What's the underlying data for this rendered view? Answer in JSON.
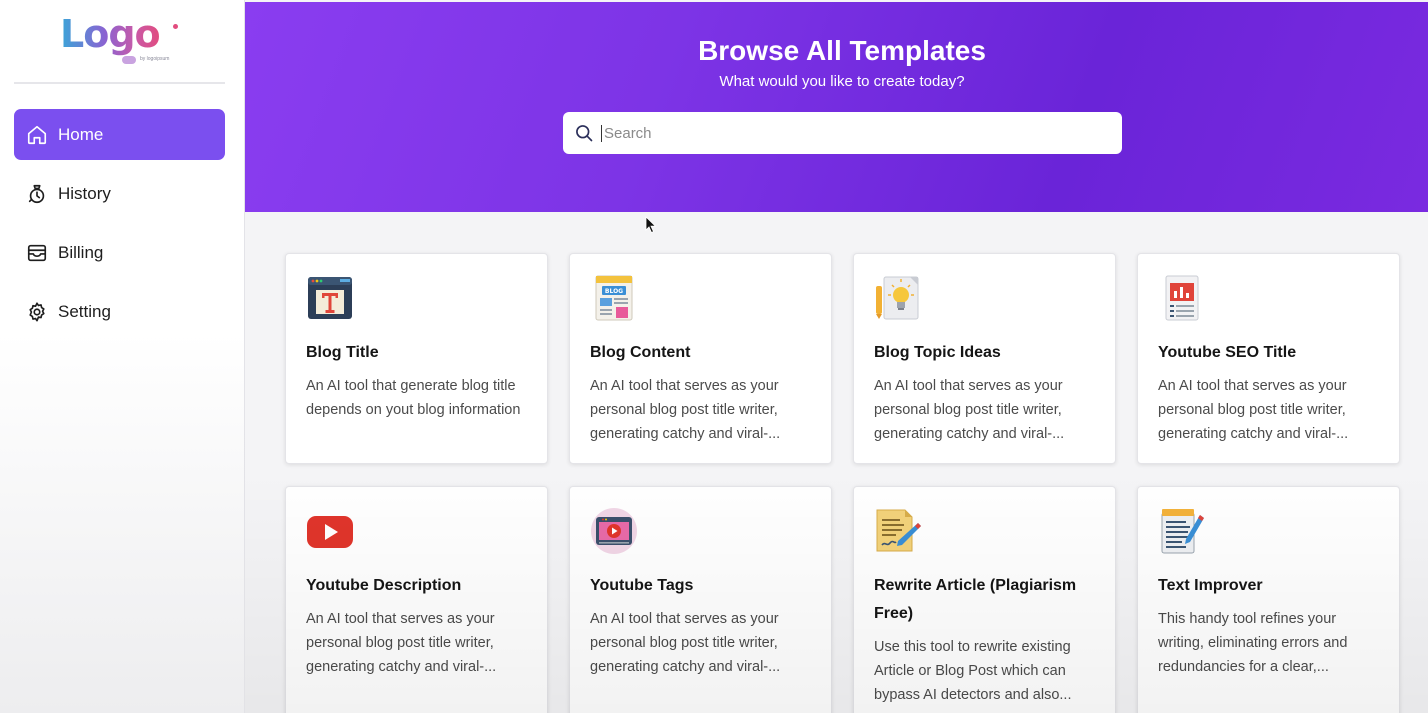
{
  "sidebar": {
    "logo_text": "Logo",
    "logo_sub": "by logoipsum",
    "items": [
      {
        "label": "Home",
        "icon": "home-icon",
        "active": true
      },
      {
        "label": "History",
        "icon": "history-icon",
        "active": false
      },
      {
        "label": "Billing",
        "icon": "billing-icon",
        "active": false
      },
      {
        "label": "Setting",
        "icon": "gear-icon",
        "active": false
      }
    ]
  },
  "hero": {
    "title": "Browse All Templates",
    "subtitle": "What would you like to create today?",
    "search_placeholder": "Search"
  },
  "templates": [
    {
      "title": "Blog Title",
      "icon": "blog-title-icon",
      "description": "An AI tool that generate blog title depends on yout blog information"
    },
    {
      "title": "Blog Content",
      "icon": "blog-content-icon",
      "description": "An AI tool that serves as your personal blog post title writer, generating catchy and viral-..."
    },
    {
      "title": "Blog Topic Ideas",
      "icon": "lightbulb-icon",
      "description": "An AI tool that serves as your personal blog post title writer, generating catchy and viral-..."
    },
    {
      "title": "Youtube SEO Title",
      "icon": "seo-report-icon",
      "description": "An AI tool that serves as your personal blog post title writer, generating catchy and viral-..."
    },
    {
      "title": "Youtube Description",
      "icon": "youtube-icon",
      "description": "An AI tool that serves as your personal blog post title writer, generating catchy and viral-..."
    },
    {
      "title": "Youtube Tags",
      "icon": "video-player-icon",
      "description": "An AI tool that serves as your personal blog post title writer, generating catchy and viral-..."
    },
    {
      "title": "Rewrite Article (Plagiarism Free)",
      "icon": "document-pen-icon",
      "description": "Use this tool to rewrite existing Article or Blog Post which can bypass AI detectors and also..."
    },
    {
      "title": "Text Improver",
      "icon": "notepad-pencil-icon",
      "description": "This handy tool refines your writing, eliminating errors and redundancies for a clear,..."
    }
  ],
  "colors": {
    "accent": "#7b4fef",
    "hero_start": "#8a3df0",
    "hero_end": "#6a24d8"
  }
}
